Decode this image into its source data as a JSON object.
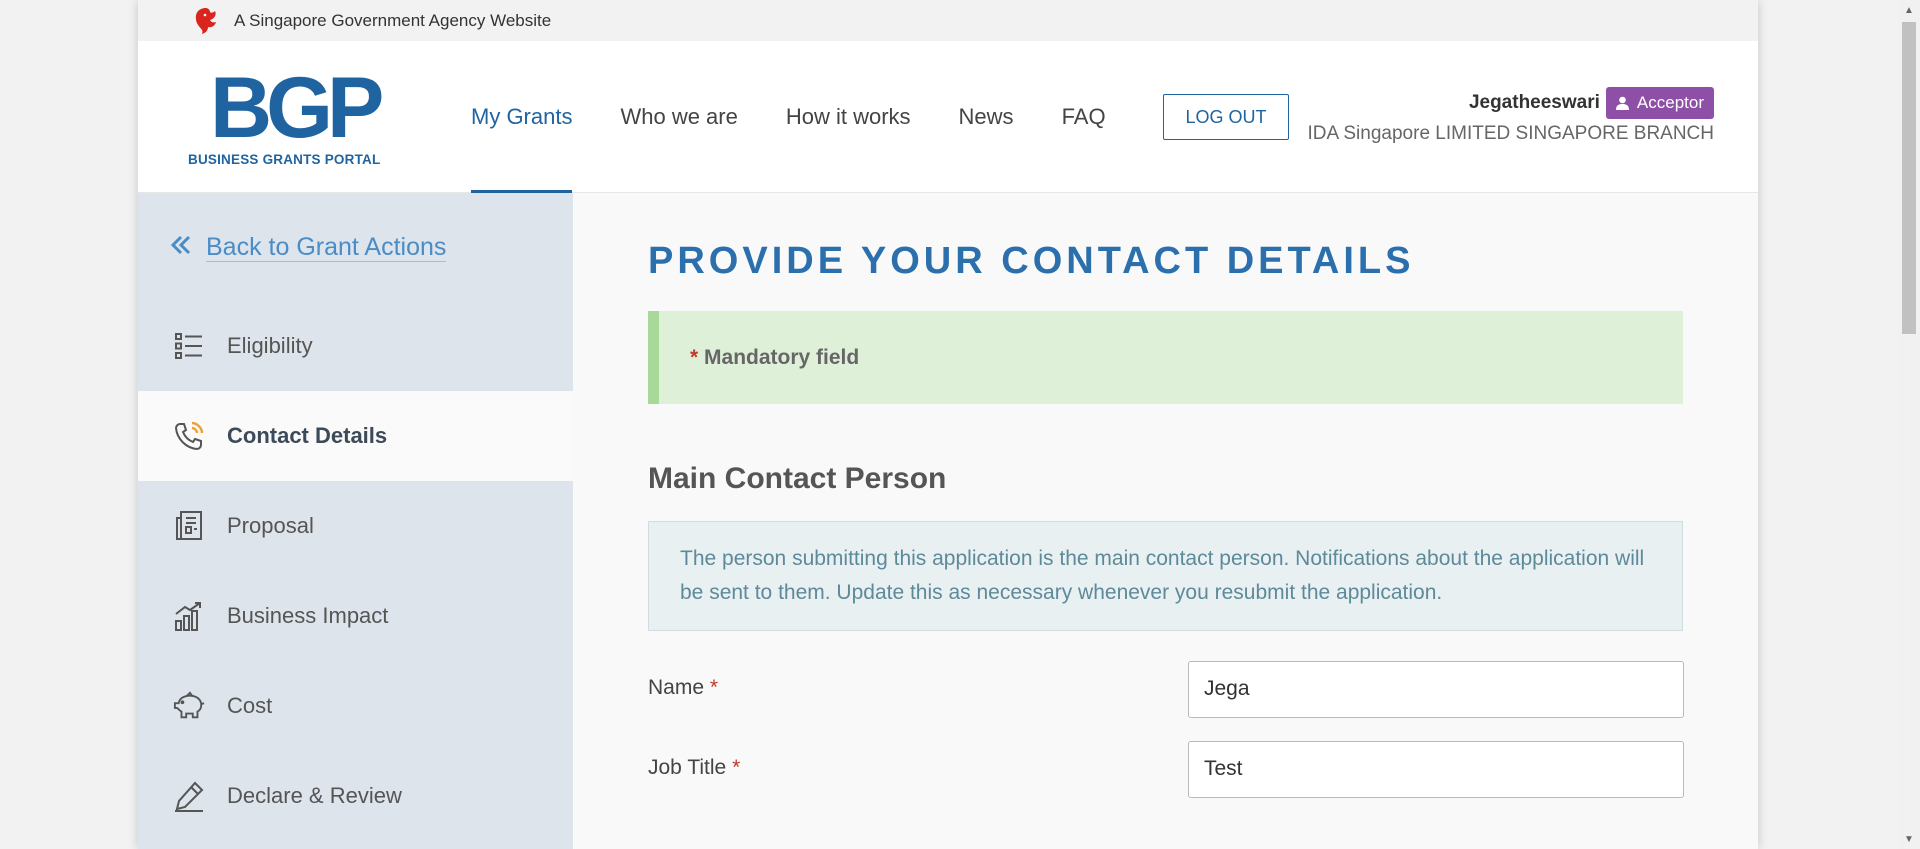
{
  "masthead": {
    "text": "A Singapore Government Agency Website"
  },
  "logo": {
    "mark": "BGP",
    "subtitle": "BUSINESS GRANTS PORTAL"
  },
  "nav": {
    "items": [
      {
        "label": "My Grants",
        "active": true
      },
      {
        "label": "Who we are"
      },
      {
        "label": "How it works"
      },
      {
        "label": "News"
      },
      {
        "label": "FAQ"
      }
    ],
    "logout_label": "LOG OUT"
  },
  "user": {
    "name": "Jegatheeswari",
    "role": "Acceptor",
    "organization": "IDA Singapore LIMITED SINGAPORE BRANCH"
  },
  "sidebar": {
    "back_label": "Back to Grant Actions",
    "items": [
      {
        "label": "Eligibility",
        "icon": "list-icon"
      },
      {
        "label": "Contact Details",
        "icon": "phone-icon",
        "active": true
      },
      {
        "label": "Proposal",
        "icon": "document-icon"
      },
      {
        "label": "Business Impact",
        "icon": "chart-icon"
      },
      {
        "label": "Cost",
        "icon": "piggy-bank-icon"
      },
      {
        "label": "Declare & Review",
        "icon": "pen-icon"
      }
    ]
  },
  "main": {
    "title": "PROVIDE YOUR CONTACT DETAILS",
    "mandatory_star": "*",
    "mandatory_text": "Mandatory field",
    "section_title": "Main Contact Person",
    "info_text": "The person submitting this application is the main contact person. Notifications about the application will be sent to them. Update this as necessary whenever you resubmit the application.",
    "fields": [
      {
        "label": "Name",
        "value": "Jega"
      },
      {
        "label": "Job Title",
        "value": "Test"
      }
    ]
  },
  "colors": {
    "brand_blue": "#1f64a1",
    "accent_purple": "#8e50a6",
    "success_bg": "#dff0d8",
    "required_red": "#c0392b"
  }
}
